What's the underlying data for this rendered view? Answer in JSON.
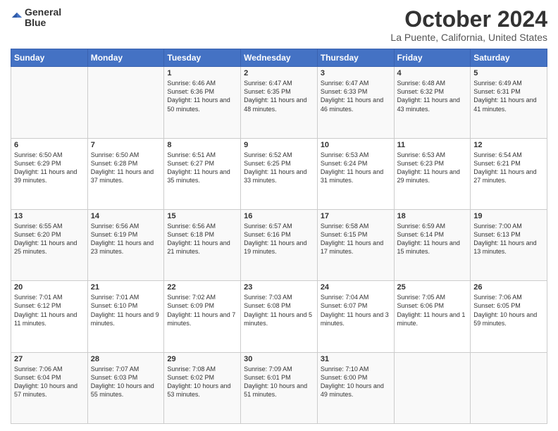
{
  "logo": {
    "line1": "General",
    "line2": "Blue"
  },
  "title": "October 2024",
  "subtitle": "La Puente, California, United States",
  "days_of_week": [
    "Sunday",
    "Monday",
    "Tuesday",
    "Wednesday",
    "Thursday",
    "Friday",
    "Saturday"
  ],
  "weeks": [
    [
      {
        "day": "",
        "content": ""
      },
      {
        "day": "",
        "content": ""
      },
      {
        "day": "1",
        "content": "Sunrise: 6:46 AM\nSunset: 6:36 PM\nDaylight: 11 hours and 50 minutes."
      },
      {
        "day": "2",
        "content": "Sunrise: 6:47 AM\nSunset: 6:35 PM\nDaylight: 11 hours and 48 minutes."
      },
      {
        "day": "3",
        "content": "Sunrise: 6:47 AM\nSunset: 6:33 PM\nDaylight: 11 hours and 46 minutes."
      },
      {
        "day": "4",
        "content": "Sunrise: 6:48 AM\nSunset: 6:32 PM\nDaylight: 11 hours and 43 minutes."
      },
      {
        "day": "5",
        "content": "Sunrise: 6:49 AM\nSunset: 6:31 PM\nDaylight: 11 hours and 41 minutes."
      }
    ],
    [
      {
        "day": "6",
        "content": "Sunrise: 6:50 AM\nSunset: 6:29 PM\nDaylight: 11 hours and 39 minutes."
      },
      {
        "day": "7",
        "content": "Sunrise: 6:50 AM\nSunset: 6:28 PM\nDaylight: 11 hours and 37 minutes."
      },
      {
        "day": "8",
        "content": "Sunrise: 6:51 AM\nSunset: 6:27 PM\nDaylight: 11 hours and 35 minutes."
      },
      {
        "day": "9",
        "content": "Sunrise: 6:52 AM\nSunset: 6:25 PM\nDaylight: 11 hours and 33 minutes."
      },
      {
        "day": "10",
        "content": "Sunrise: 6:53 AM\nSunset: 6:24 PM\nDaylight: 11 hours and 31 minutes."
      },
      {
        "day": "11",
        "content": "Sunrise: 6:53 AM\nSunset: 6:23 PM\nDaylight: 11 hours and 29 minutes."
      },
      {
        "day": "12",
        "content": "Sunrise: 6:54 AM\nSunset: 6:21 PM\nDaylight: 11 hours and 27 minutes."
      }
    ],
    [
      {
        "day": "13",
        "content": "Sunrise: 6:55 AM\nSunset: 6:20 PM\nDaylight: 11 hours and 25 minutes."
      },
      {
        "day": "14",
        "content": "Sunrise: 6:56 AM\nSunset: 6:19 PM\nDaylight: 11 hours and 23 minutes."
      },
      {
        "day": "15",
        "content": "Sunrise: 6:56 AM\nSunset: 6:18 PM\nDaylight: 11 hours and 21 minutes."
      },
      {
        "day": "16",
        "content": "Sunrise: 6:57 AM\nSunset: 6:16 PM\nDaylight: 11 hours and 19 minutes."
      },
      {
        "day": "17",
        "content": "Sunrise: 6:58 AM\nSunset: 6:15 PM\nDaylight: 11 hours and 17 minutes."
      },
      {
        "day": "18",
        "content": "Sunrise: 6:59 AM\nSunset: 6:14 PM\nDaylight: 11 hours and 15 minutes."
      },
      {
        "day": "19",
        "content": "Sunrise: 7:00 AM\nSunset: 6:13 PM\nDaylight: 11 hours and 13 minutes."
      }
    ],
    [
      {
        "day": "20",
        "content": "Sunrise: 7:01 AM\nSunset: 6:12 PM\nDaylight: 11 hours and 11 minutes."
      },
      {
        "day": "21",
        "content": "Sunrise: 7:01 AM\nSunset: 6:10 PM\nDaylight: 11 hours and 9 minutes."
      },
      {
        "day": "22",
        "content": "Sunrise: 7:02 AM\nSunset: 6:09 PM\nDaylight: 11 hours and 7 minutes."
      },
      {
        "day": "23",
        "content": "Sunrise: 7:03 AM\nSunset: 6:08 PM\nDaylight: 11 hours and 5 minutes."
      },
      {
        "day": "24",
        "content": "Sunrise: 7:04 AM\nSunset: 6:07 PM\nDaylight: 11 hours and 3 minutes."
      },
      {
        "day": "25",
        "content": "Sunrise: 7:05 AM\nSunset: 6:06 PM\nDaylight: 11 hours and 1 minute."
      },
      {
        "day": "26",
        "content": "Sunrise: 7:06 AM\nSunset: 6:05 PM\nDaylight: 10 hours and 59 minutes."
      }
    ],
    [
      {
        "day": "27",
        "content": "Sunrise: 7:06 AM\nSunset: 6:04 PM\nDaylight: 10 hours and 57 minutes."
      },
      {
        "day": "28",
        "content": "Sunrise: 7:07 AM\nSunset: 6:03 PM\nDaylight: 10 hours and 55 minutes."
      },
      {
        "day": "29",
        "content": "Sunrise: 7:08 AM\nSunset: 6:02 PM\nDaylight: 10 hours and 53 minutes."
      },
      {
        "day": "30",
        "content": "Sunrise: 7:09 AM\nSunset: 6:01 PM\nDaylight: 10 hours and 51 minutes."
      },
      {
        "day": "31",
        "content": "Sunrise: 7:10 AM\nSunset: 6:00 PM\nDaylight: 10 hours and 49 minutes."
      },
      {
        "day": "",
        "content": ""
      },
      {
        "day": "",
        "content": ""
      }
    ]
  ]
}
